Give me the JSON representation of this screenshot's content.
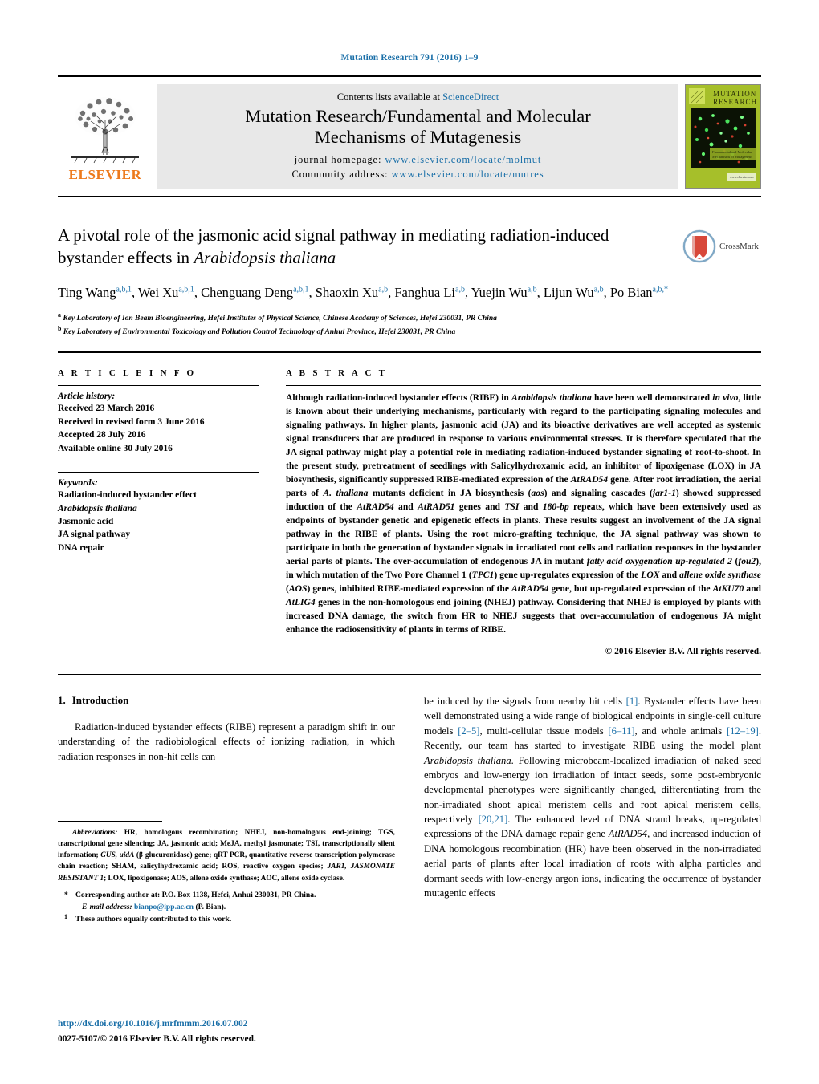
{
  "running_head": "Mutation Research 791 (2016) 1–9",
  "masthead": {
    "publisher_name": "ELSEVIER",
    "contents_prefix": "Contents lists available at ",
    "contents_link": "ScienceDirect",
    "journal_title_line1": "Mutation Research/Fundamental and Molecular",
    "journal_title_line2": "Mechanisms of Mutagenesis",
    "homepage_label": "journal homepage: ",
    "homepage_url": "www.elsevier.com/locate/molmut",
    "community_label": "Community address: ",
    "community_url": "www.elsevier.com/locate/mutres",
    "cover_title_line1": "MUTATION",
    "cover_title_line2": "RESEARCH",
    "cover_sub_line1": "Fundamental and Molecular",
    "cover_sub_line2": "Mechanisms of Mutagenesis",
    "cover_footer": "www.elsevier.com"
  },
  "article": {
    "title_part1": "A pivotal role of the jasmonic acid signal pathway in mediating radiation-induced bystander effects in ",
    "title_italic": "Arabidopsis thaliana",
    "crossmark_label": "CrossMark",
    "authors_line1": "Ting Wang",
    "authors_html": "authors",
    "affiliation_a": "Key Laboratory of Ion Beam Bioengineering, Hefei Institutes of Physical Science, Chinese Academy of Sciences, Hefei 230031, PR China",
    "affiliation_b": "Key Laboratory of Environmental Toxicology and Pollution Control Technology of Anhui Province, Hefei 230031, PR China",
    "authors": [
      {
        "name": "Ting Wang",
        "marks": "a,b,1"
      },
      {
        "name": "Wei Xu",
        "marks": "a,b,1"
      },
      {
        "name": "Chenguang Deng",
        "marks": "a,b,1"
      },
      {
        "name": "Shaoxin Xu",
        "marks": "a,b"
      },
      {
        "name": "Fanghua Li",
        "marks": "a,b"
      },
      {
        "name": "Yuejin Wu",
        "marks": "a,b"
      },
      {
        "name": "Lijun Wu",
        "marks": "a,b"
      },
      {
        "name": "Po Bian",
        "marks": "a,b,*"
      }
    ]
  },
  "article_info": {
    "heading": "A R T I C L E   I N F O",
    "history_label": "Article history:",
    "history": [
      "Received 23 March 2016",
      "Received in revised form 3 June 2016",
      "Accepted 28 July 2016",
      "Available online 30 July 2016"
    ],
    "keywords_label": "Keywords:",
    "keywords": [
      "Radiation-induced bystander effect",
      "Arabidopsis thaliana",
      "Jasmonic acid",
      "JA signal pathway",
      "DNA repair"
    ],
    "keyword_italic_index": 1
  },
  "abstract": {
    "heading": "A B S T R A C T",
    "paragraph": "Although radiation-induced bystander effects (RIBE) in Arabidopsis thaliana have been well demonstrated in vivo, little is known about their underlying mechanisms, particularly with regard to the participating signaling molecules and signaling pathways. In higher plants, jasmonic acid (JA) and its bioactive derivatives are well accepted as systemic signal transducers that are produced in response to various environmental stresses. It is therefore speculated that the JA signal pathway might play a potential role in mediating radiation-induced bystander signaling of root-to-shoot. In the present study, pretreatment of seedlings with Salicylhydroxamic acid, an inhibitor of lipoxigenase (LOX) in JA biosynthesis, significantly suppressed RIBE-mediated expression of the AtRAD54 gene. After root irradiation, the aerial parts of A. thaliana mutants deficient in JA biosynthesis (aos) and signaling cascades (jar1-1) showed suppressed induction of the AtRAD54 and AtRAD51 genes and TSI and 180-bp repeats, which have been extensively used as endpoints of bystander genetic and epigenetic effects in plants. These results suggest an involvement of the JA signal pathway in the RIBE of plants. Using the root micro-grafting technique, the JA signal pathway was shown to participate in both the generation of bystander signals in irradiated root cells and radiation responses in the bystander aerial parts of plants. The over-accumulation of endogenous JA in mutant fatty acid oxygenation up-regulated 2 (fou2), in which mutation of the Two Pore Channel 1 (TPC1) gene up-regulates expression of the LOX and allene oxide synthase (AOS) genes, inhibited RIBE-mediated expression of the AtRAD54 gene, but up-regulated expression of the AtKU70 and AtLIG4 genes in the non-homologous end joining (NHEJ) pathway. Considering that NHEJ is employed by plants with increased DNA damage, the switch from HR to NHEJ suggests that over-accumulation of endogenous JA might enhance the radiosensitivity of plants in terms of RIBE.",
    "copyright": "© 2016 Elsevier B.V. All rights reserved."
  },
  "introduction": {
    "number": "1.",
    "heading": "Introduction",
    "para_left": "Radiation-induced bystander effects (RIBE) represent a paradigm shift in our understanding of the radiobiological effects of ionizing radiation, in which radiation responses in non-hit cells can",
    "para_right": "be induced by the signals from nearby hit cells [1]. Bystander effects have been well demonstrated using a wide range of biological endpoints in single-cell culture models [2–5], multi-cellular tissue models [6–11], and whole animals [12–19]. Recently, our team has started to investigate RIBE using the model plant Arabidopsis thaliana. Following microbeam-localized irradiation of naked seed embryos and low-energy ion irradiation of intact seeds, some post-embryonic developmental phenotypes were significantly changed, differentiating from the non-irradiated shoot apical meristem cells and root apical meristem cells, respectively [20,21]. The enhanced level of DNA strand breaks, up-regulated expressions of the DNA damage repair gene AtRAD54, and increased induction of DNA homologous recombination (HR) have been observed in the non-irradiated aerial parts of plants after local irradiation of roots with alpha particles and dormant seeds with low-energy argon ions, indicating the occurrence of bystander mutagenic effects"
  },
  "footnotes": {
    "abbrev_label": "Abbreviations:",
    "abbrev_text": "HR, homologous recombination; NHEJ, non-homologous end-joining; TGS, transcriptional gene silencing; JA, jasmonic acid; MeJA, methyl jasmonate; TSI, transcriptionally silent information; GUS, uidA (β-glucuronidase) gene; qRT-PCR, quantitative reverse transcription polymerase chain reaction; SHAM, salicylhydroxamic acid; ROS, reactive oxygen species; JAR1, JASMONATE RESISTANT 1; LOX, lipoxigenase; AOS, allene oxide synthase; AOC, allene oxide cyclase.",
    "corresponding_marker": "*",
    "corresponding_text": "Corresponding author at: P.O. Box 1138, Hefei, Anhui 230031, PR China.",
    "email_label": "E-mail address:",
    "email_value": "bianpo@ipp.ac.cn",
    "email_suffix": "(P. Bian).",
    "equal_marker": "1",
    "equal_text": "These authors equally contributed to this work."
  },
  "footer": {
    "doi": "http://dx.doi.org/10.1016/j.mrfmmm.2016.07.002",
    "issn_line": "0027-5107/© 2016 Elsevier B.V. All rights reserved."
  },
  "colors": {
    "link_blue": "#1a6fa8",
    "elsevier_orange": "#ED7A1C",
    "band_gray": "#e8e8e8",
    "cover_green": "#a6bf2a"
  }
}
